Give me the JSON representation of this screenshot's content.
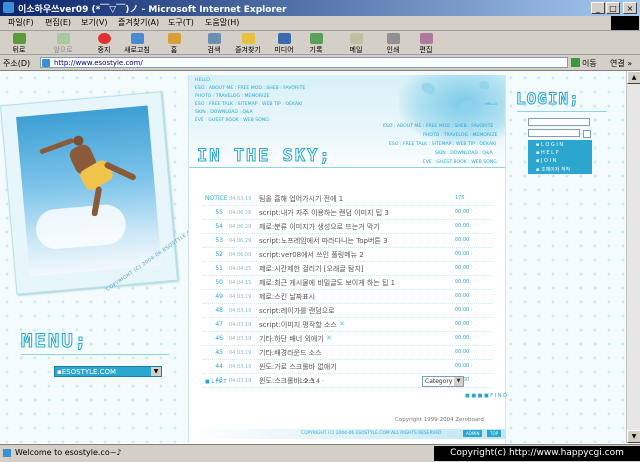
{
  "window": {
    "title": "이소하우쓰ver09 (*￣▽￣)ノ - Microsoft Internet Explorer",
    "controls": [
      "_",
      "□",
      "×"
    ]
  },
  "menubar": [
    "파일(F)",
    "편집(E)",
    "보기(V)",
    "즐겨찾기(A)",
    "도구(T)",
    "도움말(H)"
  ],
  "toolbar": [
    "뒤로",
    "앞으로",
    "중지",
    "새로고침",
    "홈",
    "검색",
    "즐겨찾기",
    "미디어",
    "기록",
    "메일",
    "인쇄",
    "편집"
  ],
  "address": {
    "label": "주소(D)",
    "url": "http://www.esostyle.com/",
    "go": "이동",
    "links": "연결 »"
  },
  "left": {
    "photo_caption": "COPYRIGHT (C) 2004-06 ESOSTYLE.COM",
    "menu_title": "MENU;",
    "menu_select": "▪ESOSTYLE.COM"
  },
  "header": {
    "nav_left": [
      "HELLO",
      "ESO : ABOUT ME : FREE MOD : SHEB : FAVORITE",
      "PHOTO : TRAVELOG : MEMORIZE",
      "ESO : FREE TALK : SITEMAP : WEB TIP : OEKAKI",
      "SKIN : DOWNLOAD : Q&A",
      "EVE : GUEST BOOK : WEB SONG"
    ],
    "nav_right": [
      "ESO : ABOUT ME : FREE MOD : SHEB : FAVORITE",
      "PHOTO : TRAVELOG : MEMORIZE",
      "ESO : FREE TALK : SITEMAP : WEB TIP : OEKAKI",
      "SKIN : DOWNLOAD : Q&A",
      "EVE : GUEST BOOK : WEB SONG"
    ],
    "hello_small": "HELLO",
    "logo": "IN THE SKY;"
  },
  "board": {
    "rows": [
      {
        "no": "NOTICE",
        "date": "04.03.19",
        "subject": "팀을 흡해 업어가시기 전에 1",
        "hits": "175"
      },
      {
        "no": "55",
        "date": "04.06.26",
        "subject": "script:내가 자주 이용하는 랜덤 이미지 팁 3",
        "hits": "00.00"
      },
      {
        "no": "54",
        "date": "04.06.29",
        "subject": "제로:분류 이미지가 생성으로 뜨는거 막기",
        "hits": "00.00"
      },
      {
        "no": "53",
        "date": "04.06.29",
        "subject": "script:노프레임에서 따라다니는 Top버튼 3",
        "hits": "00.00"
      },
      {
        "no": "52",
        "date": "04.06.09",
        "subject": "script:ver08에서 쓰인 풀링메뉴 2",
        "hits": "00.00"
      },
      {
        "no": "51",
        "date": "04.04.25",
        "subject": "제로:시간제한 걸리기 [오래글 탐지]",
        "hits": "00.00"
      },
      {
        "no": "50",
        "date": "04.04.15",
        "subject": "제로:최근 게시물에 비밀글도 보이게 하는 팁 1",
        "hits": "00.00"
      },
      {
        "no": "49",
        "date": "04.03.19",
        "subject": "제로:스킨 날짜표시",
        "hits": "00.00"
      },
      {
        "no": "48",
        "date": "04.03.19",
        "subject": "script:레이가를 랜덤으로",
        "hits": "00.00"
      },
      {
        "no": "47",
        "date": "04.03.19",
        "subject": "script:이미지 평작할 소스",
        "hits": "00.00",
        "x": true
      },
      {
        "no": "46",
        "date": "04.03.19",
        "subject": "기타:하단 배너 외에기",
        "hits": "00.00",
        "x": true
      },
      {
        "no": "45",
        "date": "04.03.19",
        "subject": "기타:배경라운드 소스",
        "hits": "00.00"
      },
      {
        "no": "44",
        "date": "04.03.19",
        "subject": "윈도:가로 스크롤바 없애기",
        "hits": "00.00"
      },
      {
        "no": "43",
        "date": "04.03.19",
        "subject": "윈도:스크롤바 소스",
        "hits": "00.00"
      }
    ],
    "list_label": "■ L I S T",
    "pages": "1 2 3 4 ·",
    "category": "Category",
    "find_label": "■ ■ ■ ■ F I N D",
    "copyright": "Copyright 1999-2004 Zeroboard",
    "footer": "COPYRIGHT (C) 2004-06 ESOSTYLE.COM ALL RIGHTS RESERVED",
    "footer_btns": [
      "ADMIN",
      "TOP"
    ]
  },
  "right": {
    "login_title": "LOGIN;",
    "menu": [
      "▪ L O G I N",
      "▪ H E L P",
      "▪ J O I N",
      "▪ 조체이저 적작"
    ]
  },
  "status": {
    "text": "Welcome to esostyle.co~♪",
    "watermark": "Copyright(c) http://www.happycgi.com"
  },
  "colors": {
    "accent": "#2aa6cf",
    "title_bar": "#0a246a",
    "chrome": "#d4d0c8"
  }
}
